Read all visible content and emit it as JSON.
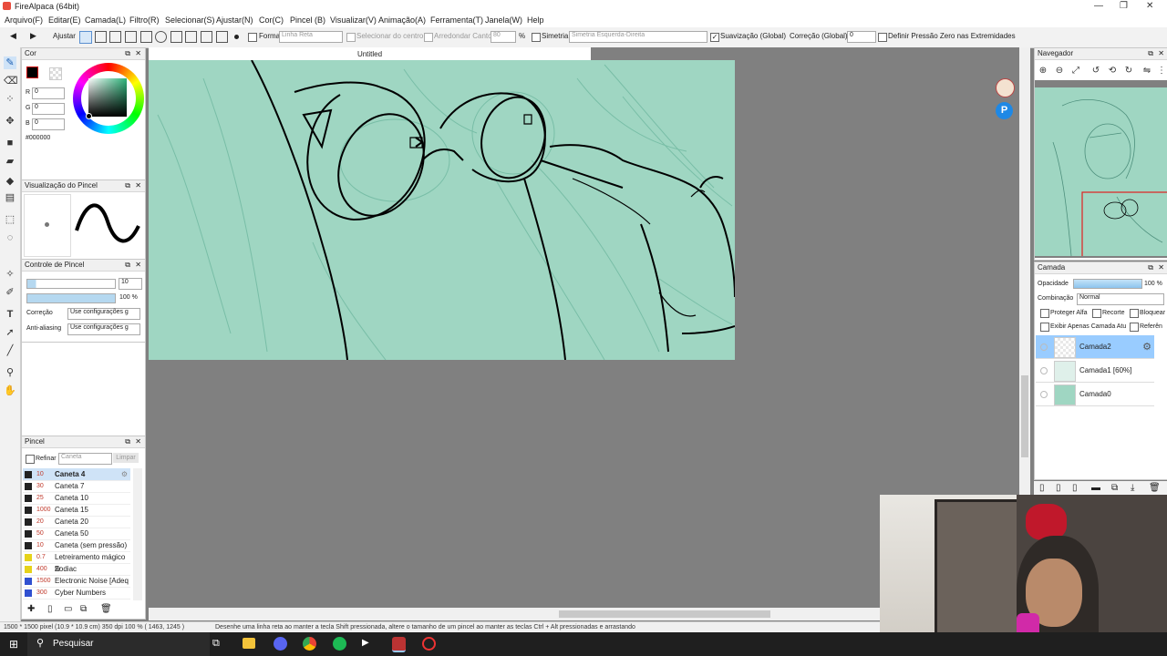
{
  "window": {
    "title": "FireAlpaca (64bit)",
    "min": "—",
    "max": "❐",
    "close": "✕"
  },
  "menu": [
    "Arquivo(F)",
    "Editar(E)",
    "Camada(L)",
    "Filtro(R)",
    "Selecionar(S)",
    "Ajustar(N)",
    "Cor(C)",
    "Pincel (B)",
    "Visualizar(V)",
    "Animação(A)",
    "Ferramenta(T)",
    "Janela(W)",
    "Help"
  ],
  "toolbar": {
    "ajustar": "Ajustar",
    "forma": "Forma",
    "forma_value": "Linha Reta",
    "selecionar_centro": "Selecionar do centro",
    "arredondar_canto": "Arredondar Canto",
    "arredondar_value": "80",
    "percent": "%",
    "simetria": "Simetria",
    "simetria_value": "Simetria Esquerda-Direita",
    "suavizacao": "Suavização (Global)",
    "correcao": "Correção (Global)",
    "correcao_value": "0",
    "pressao_zero": "Definir Pressão Zero nas Extremidades"
  },
  "color_panel": {
    "title": "Cor",
    "r_label": "R",
    "r": "0",
    "g_label": "G",
    "g": "0",
    "b_label": "B",
    "b": "0",
    "hex": "#000000"
  },
  "brush_preview": {
    "title": "Visualização do Pincel"
  },
  "brush_control": {
    "title": "Controle de Pincel",
    "size": "10",
    "opacity": "100 %",
    "correcao_label": "Correção",
    "correcao_value": "Use configurações g",
    "antialias_label": "Anti-aliasing",
    "antialias_value": "Use configurações g"
  },
  "brush_panel": {
    "title": "Pincel",
    "refine": "Refinar",
    "search_placeholder": "Caneta",
    "clear": "Limpar",
    "items": [
      {
        "size": "10",
        "name": "Caneta 4",
        "color": "#222222"
      },
      {
        "size": "30",
        "name": "Caneta 7",
        "color": "#222222"
      },
      {
        "size": "25",
        "name": "Caneta 10",
        "color": "#222222"
      },
      {
        "size": "1000",
        "name": "Caneta 15",
        "color": "#222222"
      },
      {
        "size": "20",
        "name": "Caneta 20",
        "color": "#222222"
      },
      {
        "size": "50",
        "name": "Caneta 50",
        "color": "#222222"
      },
      {
        "size": "10",
        "name": "Caneta (sem pressão)",
        "color": "#222222"
      },
      {
        "size": "0.7",
        "name": "Letreiramento mágico fir",
        "color": "#e6d21a"
      },
      {
        "size": "400",
        "name": "Zodiac",
        "color": "#e6d21a"
      },
      {
        "size": "1500",
        "name": "Electronic Noise [Adeq",
        "color": "#3050d0"
      },
      {
        "size": "300",
        "name": "Cyber Numbers",
        "color": "#3050d0"
      }
    ]
  },
  "canvas": {
    "tab": "Untitled"
  },
  "navigator": {
    "title": "Navegador"
  },
  "layer_panel": {
    "title": "Camada",
    "opacity_label": "Opacidade",
    "opacity_value": "100 %",
    "blend_label": "Combinação",
    "blend_value": "Normal",
    "protect_alpha": "Proteger Alfa",
    "clipping": "Recorte",
    "lock": "Bloquear",
    "show_only": "Exibir Apenas Camada Atu",
    "reference": "Referên",
    "layers": [
      {
        "name": "Camada2",
        "selected": true
      },
      {
        "name": "Camada1 [60%]",
        "selected": false
      },
      {
        "name": "Camada0",
        "selected": false
      }
    ]
  },
  "status": {
    "dims": "1500 * 1500 pixel  (10.9 * 10.9 cm)  350 dpi  100 %  ( 1463, 1245 )",
    "hint": "Desenhe uma linha reta ao manter a tecla Shift pressionada, altere o tamanho de um pincel ao manter as teclas Ctrl + Alt pressionadas e arrastando"
  },
  "taskbar": {
    "search": "Pesquisar"
  },
  "colors": {
    "canvas": "#9fd6c2",
    "accent": "#99ccff",
    "selected_layer": "#99ccff"
  }
}
